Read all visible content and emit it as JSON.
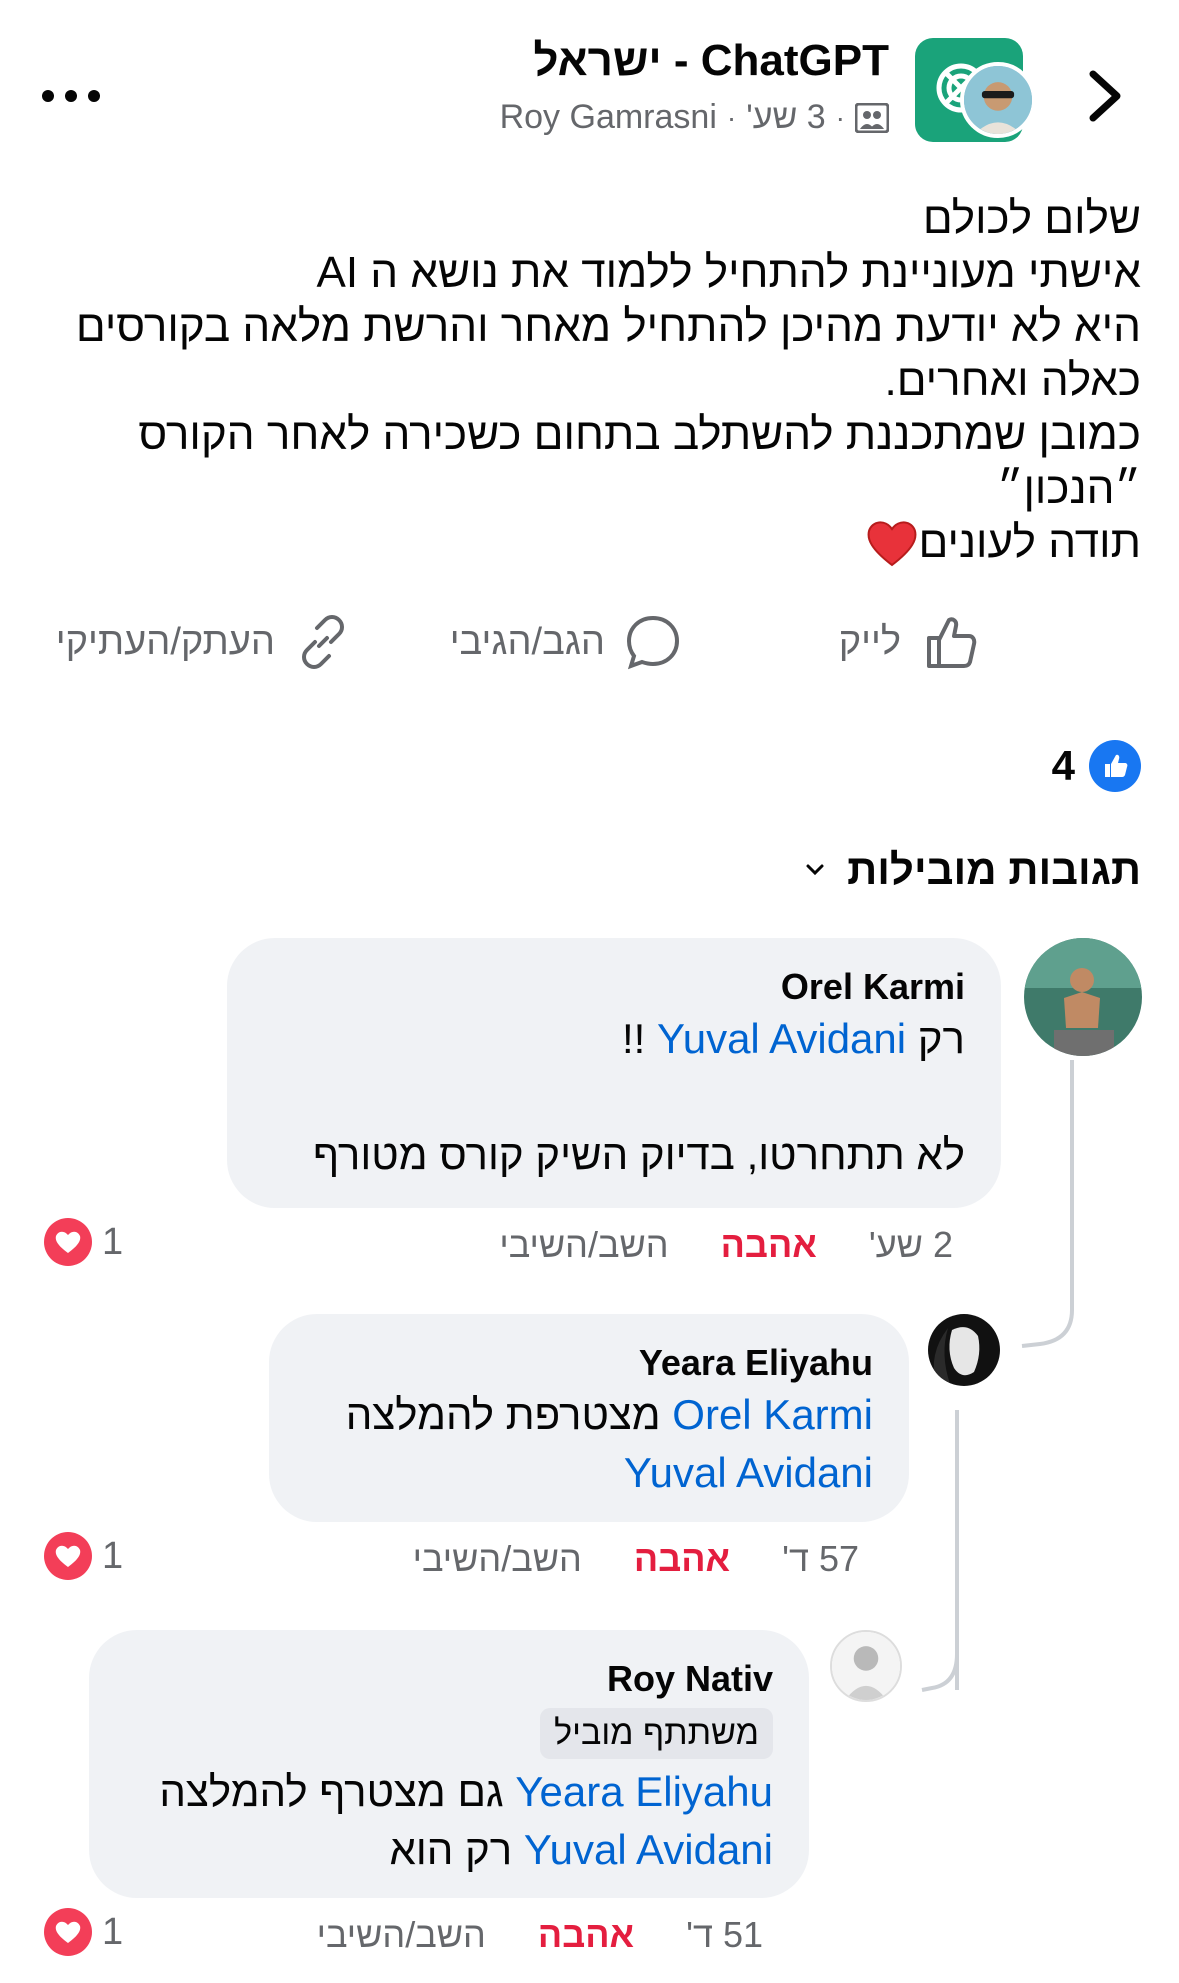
{
  "header": {
    "group_name": "ChatGPT - ישראל",
    "author": "Roy Gamrasni",
    "time": "3 שע'",
    "separator": "·"
  },
  "post": {
    "text": "שלום לכולם\nאישתי מעוניינת להתחיל ללמוד את נושא ה AI\nהיא לא יודעת מהיכן להתחיל מאחר והרשת מלאה בקורסים כאלה ואחרים.\nכמובן שמתכננת להשתלב בתחום כשכירה לאחר הקורס ״הנכון״\nתודה לעונים"
  },
  "actions": {
    "like": "לייק",
    "comment": "הגב/הגיבי",
    "share": "העתק/העתיקי"
  },
  "reactions": {
    "count": "4"
  },
  "comments_sort": {
    "label": "תגובות מובילות"
  },
  "comments": [
    {
      "name": "Orel Karmi",
      "prefix": "רק ",
      "mention": "Yuval Avidani",
      "suffix": " !!",
      "text2": "לא תתחרטו, בדיוק השיק קורס מטורף",
      "time": "2 שע'",
      "love": "אהבה",
      "reply": "השב/השיבי",
      "reaction_count": "1"
    },
    {
      "name": "Yeara Eliyahu",
      "mention1": "Orel Karmi",
      "text": " מצטרפת להמלצה",
      "mention2": "Yuval Avidani",
      "time": "57 ד'",
      "love": "אהבה",
      "reply": "השב/השיבי",
      "reaction_count": "1"
    },
    {
      "name": "Roy Nativ",
      "role": "משתתף מוביל",
      "mention1": "Yeara Eliyahu",
      "text1": " גם מצטרף להמלצה",
      "mention2": "Yuval Avidani",
      "text2": " רק הוא",
      "time": "51 ד'",
      "love": "אהבה",
      "reply": "השב/השיבי",
      "reaction_count": "1"
    }
  ],
  "colors": {
    "accent": "#1877f2",
    "mention": "#0064d1",
    "love": "#e41e3f",
    "bubble": "#f0f2f5",
    "meta": "#65676b"
  },
  "icons": [
    "chevron-right-icon",
    "more-icon",
    "group-icon",
    "like-icon",
    "comment-icon",
    "share-icon",
    "heart-icon",
    "chevron-down-icon"
  ]
}
